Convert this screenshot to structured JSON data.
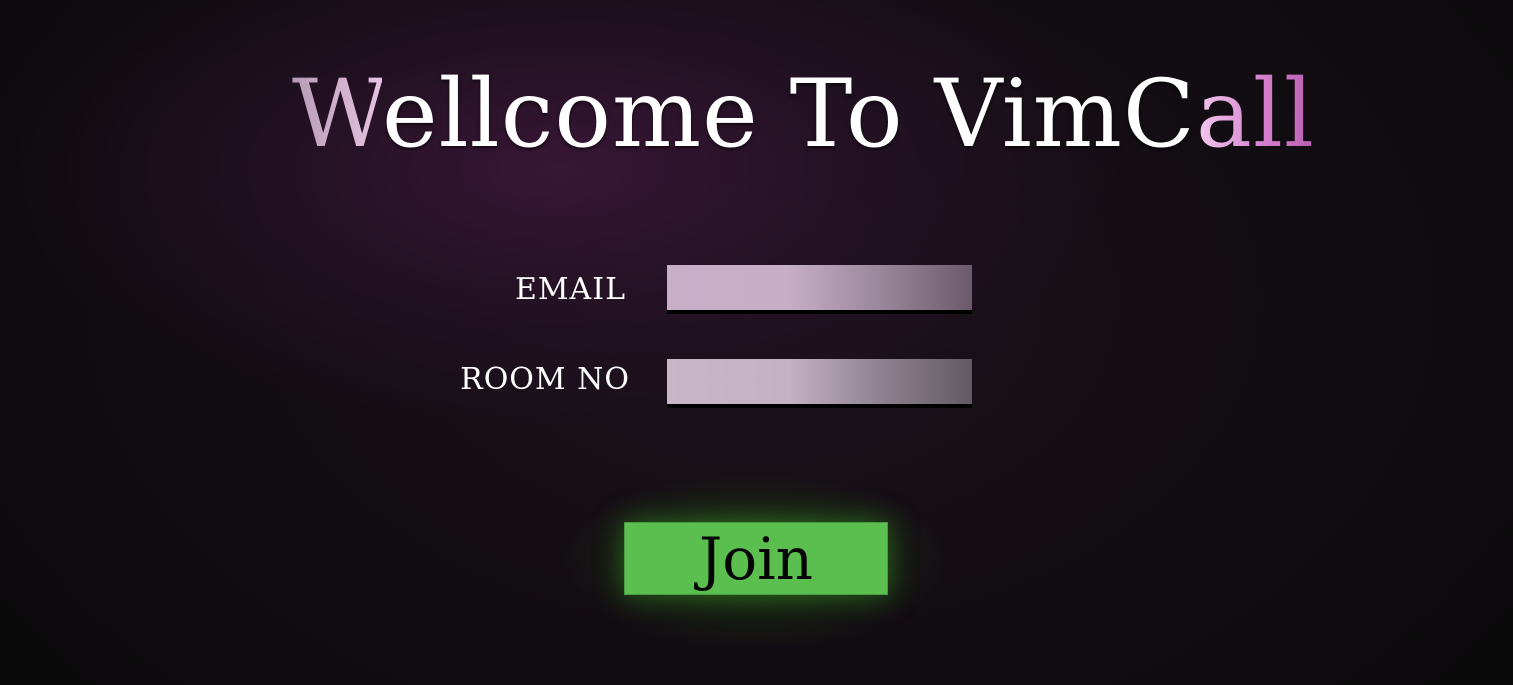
{
  "title": {
    "start": "W",
    "middle": "ellcome To VimC",
    "end": "all"
  },
  "form": {
    "email_label": "EMAIL",
    "email_value": "",
    "room_label": "ROOM NO",
    "room_value": ""
  },
  "join_button": {
    "label": "Join"
  },
  "colors": {
    "button": "#5bbf4f",
    "title_accent": "#d27ccb",
    "background": "#120d12"
  }
}
